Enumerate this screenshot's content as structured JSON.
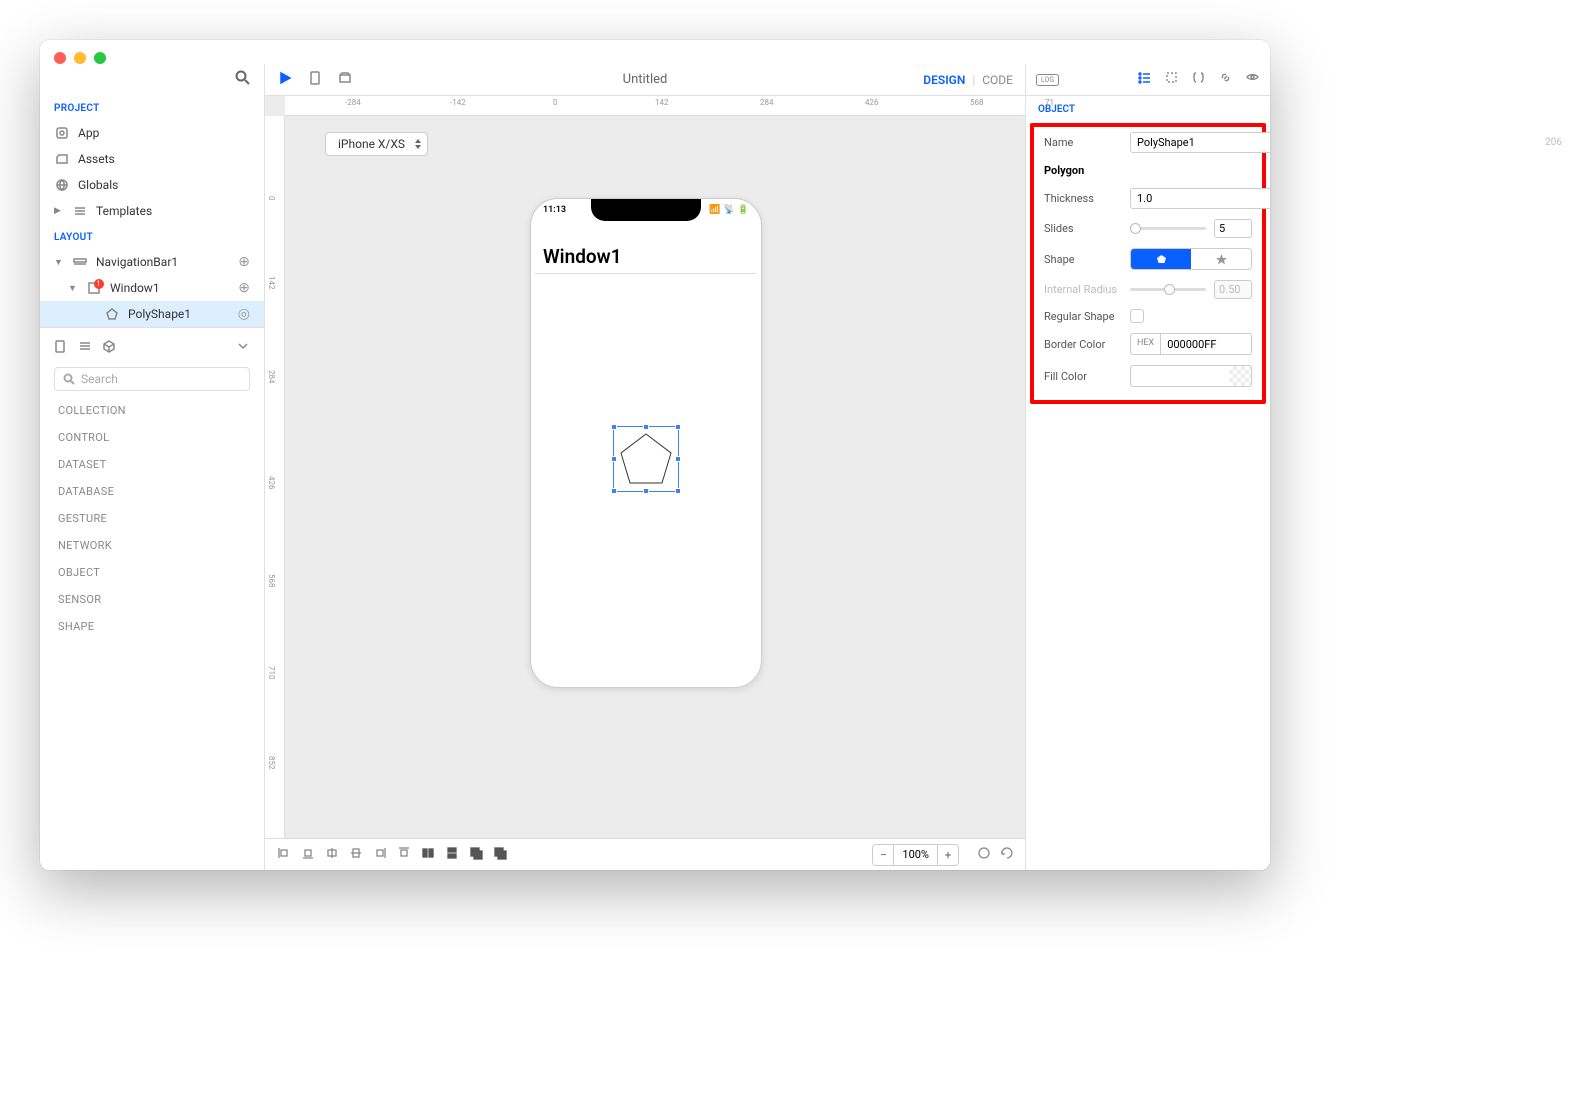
{
  "title": "Untitled",
  "modes": {
    "design": "DESIGN",
    "sep": "|",
    "code": "CODE"
  },
  "leftSidebar": {
    "sections": {
      "project": "PROJECT",
      "layout": "LAYOUT"
    },
    "project": {
      "app": "App",
      "assets": "Assets",
      "globals": "Globals",
      "templates": "Templates"
    },
    "layout": {
      "nav": "NavigationBar1",
      "win": "Window1",
      "winBadge": "1",
      "shape": "PolyShape1"
    },
    "searchPlaceholder": "Search",
    "categories": [
      "COLLECTION",
      "CONTROL",
      "DATASET",
      "DATABASE",
      "GESTURE",
      "NETWORK",
      "OBJECT",
      "SENSOR",
      "SHAPE"
    ]
  },
  "ruler": {
    "h": [
      {
        "v": "-284",
        "p": 60
      },
      {
        "v": "-142",
        "p": 165
      },
      {
        "v": "0",
        "p": 268
      },
      {
        "v": "142",
        "p": 370
      },
      {
        "v": "284",
        "p": 475
      },
      {
        "v": "426",
        "p": 580
      },
      {
        "v": "568",
        "p": 685
      },
      {
        "v": "71",
        "p": 760
      }
    ],
    "v": [
      {
        "v": "0",
        "p": 80
      },
      {
        "v": "142",
        "p": 160
      },
      {
        "v": "284",
        "p": 254
      },
      {
        "v": "426",
        "p": 360
      },
      {
        "v": "568",
        "p": 458
      },
      {
        "v": "710",
        "p": 550
      },
      {
        "v": "852",
        "p": 640
      }
    ]
  },
  "deviceSelector": "iPhone X/XS",
  "phone": {
    "time": "11:13",
    "winTitle": "Window1"
  },
  "zoom": "100%",
  "inspector": {
    "section": "OBJECT",
    "log": "LOG",
    "nameLabel": "Name",
    "nameValue": "PolyShape1",
    "nameId": "206",
    "typeLabel": "Polygon",
    "thicknessLabel": "Thickness",
    "thicknessValue": "1.0",
    "slidesLabel": "Slides",
    "slidesValue": "5",
    "shapeLabel": "Shape",
    "internalRadiusLabel": "Internal Radius",
    "internalRadiusValue": "0.50",
    "regularShapeLabel": "Regular Shape",
    "borderColorLabel": "Border Color",
    "borderColorHex": "HEX",
    "borderColorValue": "000000FF",
    "fillColorLabel": "Fill Color"
  }
}
